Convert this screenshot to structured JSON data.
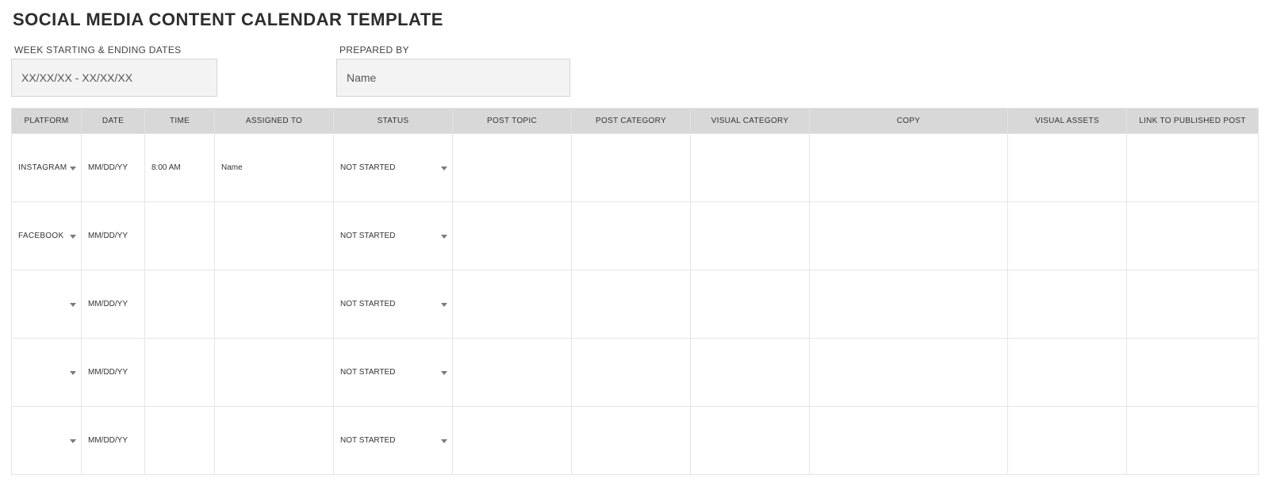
{
  "title": "SOCIAL MEDIA CONTENT CALENDAR TEMPLATE",
  "meta": {
    "week_label": "WEEK STARTING & ENDING DATES",
    "week_value": "XX/XX/XX - XX/XX/XX",
    "prepared_label": "PREPARED BY",
    "prepared_value": "Name"
  },
  "columns": {
    "platform": "PLATFORM",
    "date": "DATE",
    "time": "TIME",
    "assigned": "ASSIGNED TO",
    "status": "STATUS",
    "topic": "POST TOPIC",
    "category": "POST CATEGORY",
    "vcategory": "VISUAL CATEGORY",
    "copy": "COPY",
    "assets": "VISUAL ASSETS",
    "link": "LINK TO PUBLISHED POST"
  },
  "rows": [
    {
      "platform": "INSTAGRAM",
      "platform_class": "plat-instagram",
      "date": "MM/DD/YY",
      "time": "8:00 AM",
      "assigned": "Name",
      "status": "NOT STARTED",
      "topic": "",
      "category": "",
      "vcategory": "",
      "copy": "",
      "assets": "",
      "link": ""
    },
    {
      "platform": "FACEBOOK",
      "platform_class": "plat-facebook",
      "date": "MM/DD/YY",
      "time": "",
      "assigned": "",
      "status": "NOT STARTED",
      "topic": "",
      "category": "",
      "vcategory": "",
      "copy": "",
      "assets": "",
      "link": ""
    },
    {
      "platform": "",
      "platform_class": "plat-empty",
      "date": "MM/DD/YY",
      "time": "",
      "assigned": "",
      "status": "NOT STARTED",
      "topic": "",
      "category": "",
      "vcategory": "",
      "copy": "",
      "assets": "",
      "link": ""
    },
    {
      "platform": "",
      "platform_class": "plat-empty",
      "date": "MM/DD/YY",
      "time": "",
      "assigned": "",
      "status": "NOT STARTED",
      "topic": "",
      "category": "",
      "vcategory": "",
      "copy": "",
      "assets": "",
      "link": ""
    },
    {
      "platform": "",
      "platform_class": "plat-empty",
      "date": "MM/DD/YY",
      "time": "",
      "assigned": "",
      "status": "NOT STARTED",
      "topic": "",
      "category": "",
      "vcategory": "",
      "copy": "",
      "assets": "",
      "link": ""
    }
  ]
}
